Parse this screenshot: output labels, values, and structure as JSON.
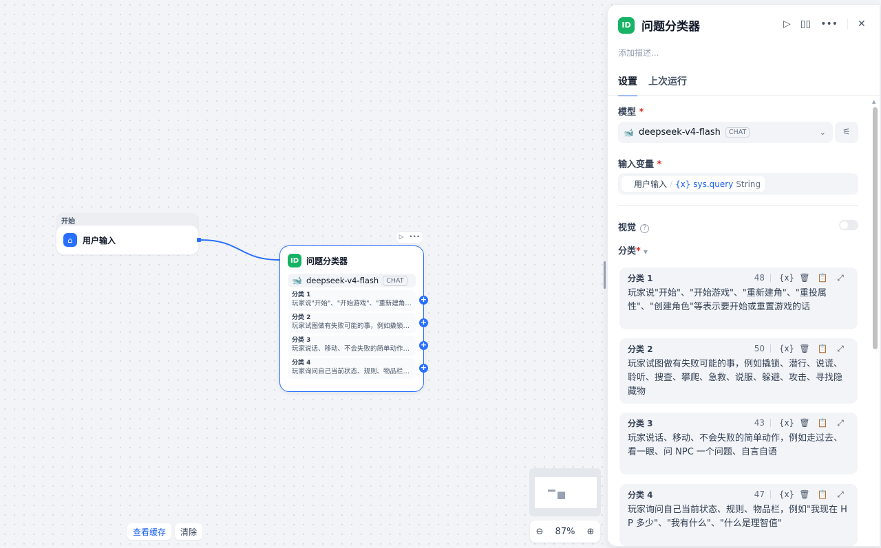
{
  "canvas": {
    "start_node": {
      "header": "开始",
      "title": "用户输入"
    },
    "qc_node": {
      "title": "问题分类器",
      "model": "deepseek-v4-flash",
      "model_tag": "CHAT",
      "classes": [
        {
          "name": "分类 1",
          "text": "玩家说\"开始\"、\"开始游戏\"、\"重新建角\"、\"重投属性\"、\"创建角色\"等表示要开始或重置游戏的话"
        },
        {
          "name": "分类 2",
          "text": "玩家试图做有失败可能的事，例如撬锁、潜行、说谎、聆听、搜查、攀爬、急救、说服、躲避、攻击、寻找隐藏物"
        },
        {
          "name": "分类 3",
          "text": "玩家说话、移动、不会失败的简单动作，例如走过去、看一眼、问 NPC 一个问题、自言自语"
        },
        {
          "name": "分类 4",
          "text": "玩家询问自己当前状态、规则、物品栏，例如\"我现在 HP 多少\"、\"我有什么\"、\"什么是理智值\""
        }
      ]
    },
    "buttons": {
      "view_cache": "查看缓存",
      "clear": "清除"
    },
    "zoom": {
      "level": "87%"
    }
  },
  "panel": {
    "title": "问题分类器",
    "desc_placeholder": "添加描述...",
    "tabs": [
      {
        "label": "设置",
        "active": true
      },
      {
        "label": "上次运行",
        "active": false
      }
    ],
    "model_label": "模型",
    "required_mark": "*",
    "model": {
      "name": "deepseek-v4-flash",
      "tag": "CHAT"
    },
    "input_var_label": "输入变量",
    "input_var": {
      "node": "用户输入",
      "separator": "/",
      "var": "{x} sys.query",
      "type": "String"
    },
    "vision_label": "视觉",
    "vision_enabled": false,
    "class_label": "分类",
    "classes": [
      {
        "name": "分类 1",
        "count": "48",
        "text": "玩家说\"开始\"、\"开始游戏\"、\"重新建角\"、\"重投属性\"、\"创建角色\"等表示要开始或重置游戏的话"
      },
      {
        "name": "分类 2",
        "count": "50",
        "text": "玩家试图做有失败可能的事，例如撬锁、潜行、说谎、聆听、搜查、攀爬、急救、说服、躲避、攻击、寻找隐藏物"
      },
      {
        "name": "分类 3",
        "count": "43",
        "text": "玩家说话、移动、不会失败的简单动作，例如走过去、看一眼、问 NPC 一个问题、自言自语"
      },
      {
        "name": "分类 4",
        "count": "47",
        "text": "玩家询问自己当前状态、规则、物品栏，例如\"我现在 HP 多少\"、\"我有什么\"、\"什么是理智值\""
      }
    ],
    "var_insert_label": "{x}"
  },
  "colors": {
    "accent": "#2970ff",
    "node_green": "#16b364",
    "required": "#d92d20"
  }
}
